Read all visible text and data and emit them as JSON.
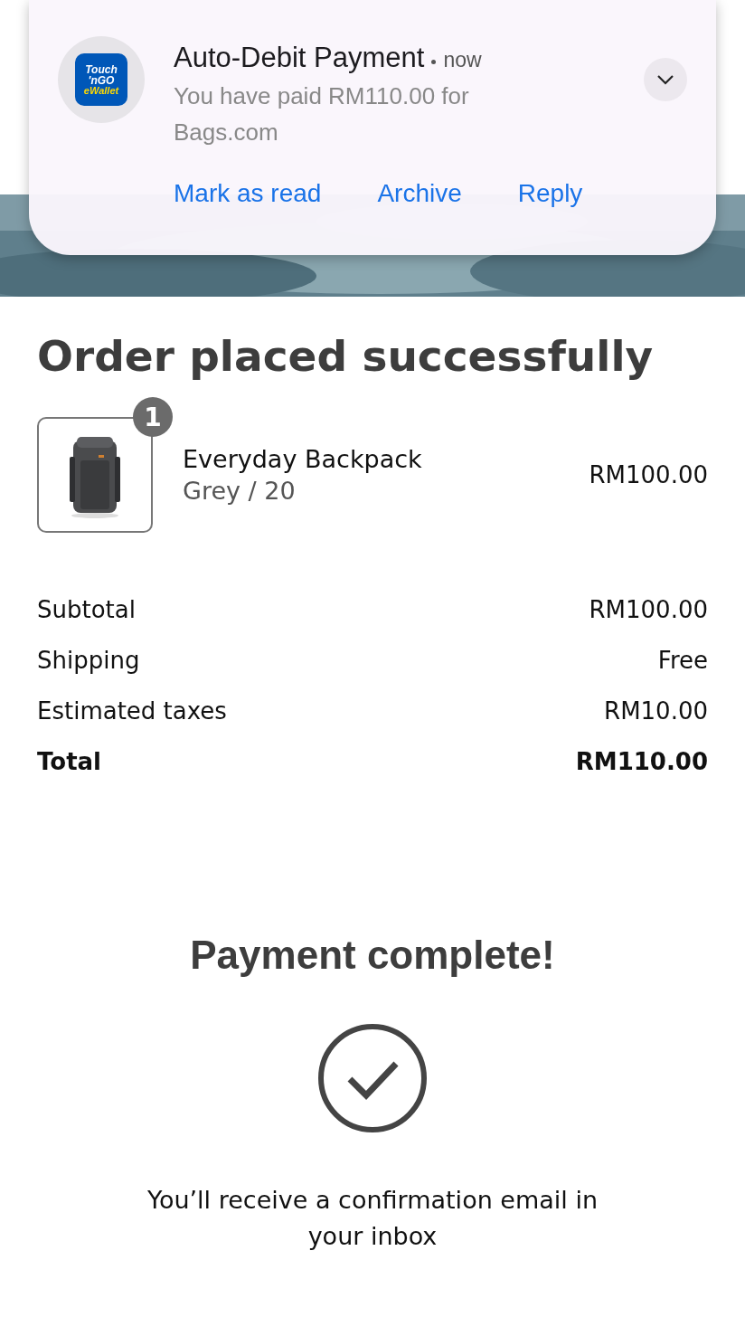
{
  "notification": {
    "app_logo": [
      "Touch",
      "'nGO",
      "eWallet"
    ],
    "title": "Auto-Debit Payment",
    "time": "now",
    "body": "You have paid RM110.00 for Bags.com",
    "actions": [
      "Mark as read",
      "Archive",
      "Reply"
    ]
  },
  "order": {
    "title": "Order placed successfully",
    "items": [
      {
        "quantity": "1",
        "name": "Everyday Backpack",
        "variant": "Grey / 20",
        "price": "RM100.00"
      }
    ],
    "summary": [
      {
        "label": "Subtotal",
        "value": "RM100.00",
        "kind": "line"
      },
      {
        "label": "Shipping",
        "value": "Free",
        "kind": "line"
      },
      {
        "label": "Estimated taxes",
        "value": "RM10.00",
        "kind": "line"
      },
      {
        "label": "Total",
        "value": "RM110.00",
        "kind": "total"
      }
    ]
  },
  "payment": {
    "title": "Payment complete!",
    "message": "You’ll receive a confirmation email in your inbox"
  }
}
